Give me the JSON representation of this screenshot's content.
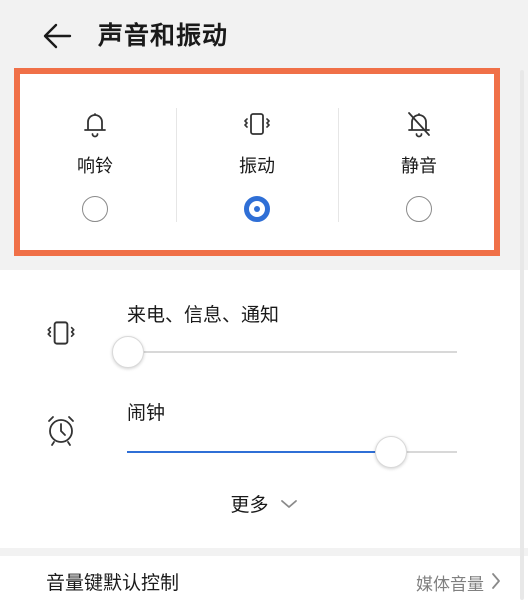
{
  "header": {
    "title": "声音和振动",
    "back_icon": "arrow-left-icon"
  },
  "sound_modes": {
    "highlight_color": "#f07048",
    "selected_color": "#2f6fd6",
    "items": [
      {
        "label": "响铃",
        "icon": "bell-icon",
        "selected": false
      },
      {
        "label": "振动",
        "icon": "vibrate-icon",
        "selected": true
      },
      {
        "label": "静音",
        "icon": "bell-off-icon",
        "selected": false
      }
    ]
  },
  "volume": {
    "rows": [
      {
        "title": "来电、信息、通知",
        "icon": "vibrate-icon",
        "level": 0.0
      },
      {
        "title": "闹钟",
        "icon": "alarm-clock-icon",
        "level": 0.8
      }
    ],
    "more_label": "更多"
  },
  "bottom": {
    "label": "音量键默认控制",
    "value": "媒体音量"
  }
}
